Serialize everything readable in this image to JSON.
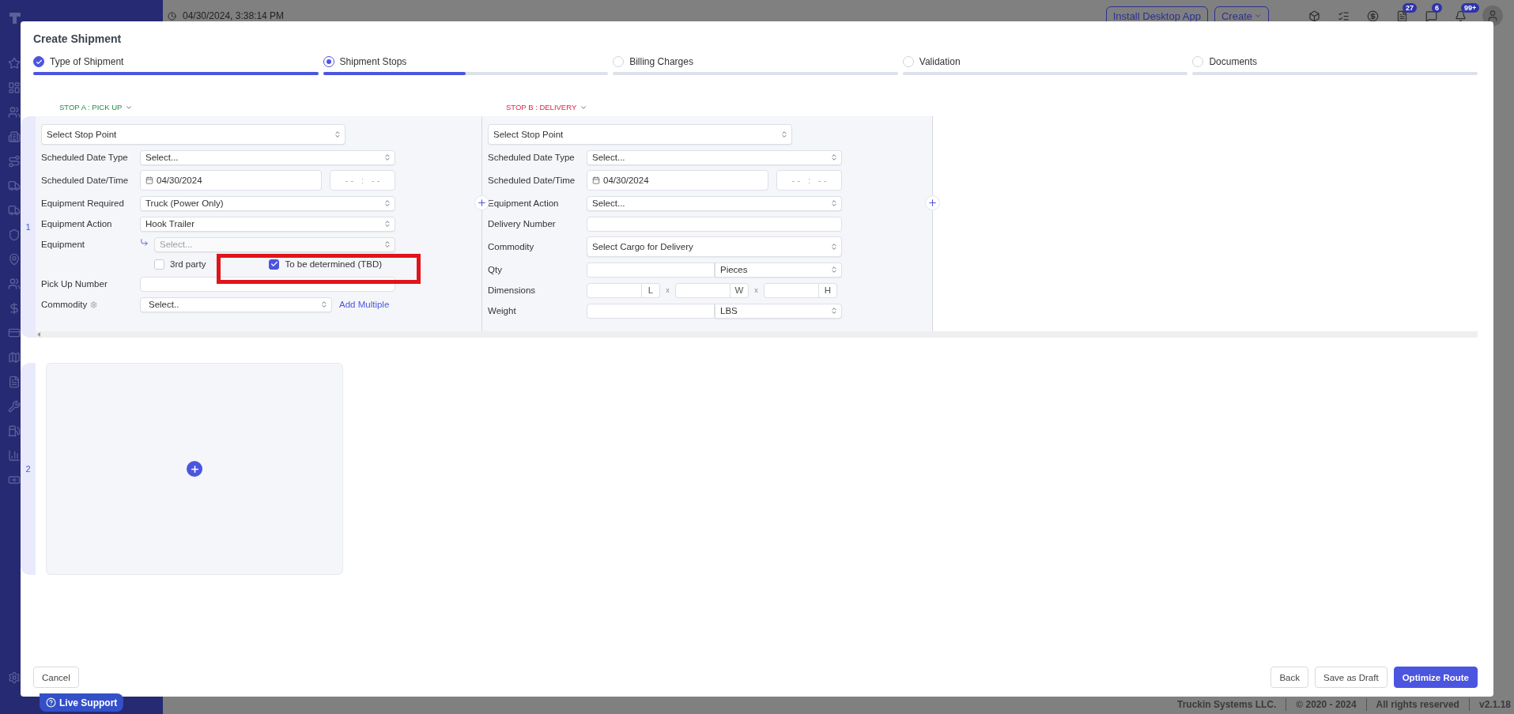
{
  "topbar": {
    "timestamp": "04/30/2024, 3:38:14 PM",
    "install_button": "Install Desktop App",
    "create_button": "Create",
    "icons": [
      {
        "kind": "box"
      },
      {
        "kind": "list"
      },
      {
        "kind": "dollar"
      },
      {
        "kind": "document",
        "badge": "27"
      },
      {
        "kind": "chat",
        "badge": "6"
      },
      {
        "kind": "bell",
        "badge": "99+"
      }
    ]
  },
  "sidebar": {
    "items": [
      {
        "kind": "star"
      },
      {
        "kind": "dashboard"
      },
      {
        "kind": "users"
      },
      {
        "kind": "building"
      },
      {
        "kind": "route"
      },
      {
        "kind": "truck"
      },
      {
        "kind": "truck"
      },
      {
        "kind": "shield"
      },
      {
        "kind": "pin"
      },
      {
        "kind": "users"
      },
      {
        "kind": "dollar"
      },
      {
        "kind": "card"
      },
      {
        "kind": "map"
      },
      {
        "kind": "document"
      },
      {
        "kind": "wrench"
      },
      {
        "kind": "fuel"
      },
      {
        "kind": "chart"
      },
      {
        "kind": "money"
      }
    ]
  },
  "modal": {
    "title": "Create Shipment",
    "steps": [
      {
        "label": "Type of Shipment",
        "kind": "done",
        "level": 1
      },
      {
        "label": "Shipment Stops",
        "kind": "current",
        "level": 0.5
      },
      {
        "label": "Billing Charges",
        "kind": "pending",
        "level": 0
      },
      {
        "label": "Validation",
        "kind": "pending",
        "level": 0
      },
      {
        "label": "Documents",
        "kind": "pending",
        "level": 0
      }
    ],
    "routes": [
      {
        "number": "1",
        "kind": "stops",
        "stops": [
          {
            "header": "STOP A : PICK UP",
            "color": "#1e8a4c",
            "fields": [
              {
                "kind": "stop_select",
                "value": "Select Stop Point"
              },
              {
                "kind": "select",
                "label": "Scheduled Date Type",
                "value": "Select..."
              },
              {
                "kind": "datetime",
                "label": "Scheduled Date/Time",
                "date": "04/30/2024",
                "time": "- -   :   - -"
              },
              {
                "kind": "select",
                "label": "Equipment Required",
                "value": "Truck (Power Only)"
              },
              {
                "kind": "select",
                "label": "Equipment Action",
                "value": "Hook Trailer"
              },
              {
                "kind": "sub_select",
                "label": "Equipment",
                "placeholder": "Select...",
                "disabled": true
              },
              {
                "kind": "checkboxes",
                "options": [
                  {
                    "label": "3rd party",
                    "checked": false,
                    "highlighted": false
                  },
                  {
                    "label": "To be determined (TBD)",
                    "checked": true,
                    "highlighted": true
                  }
                ]
              },
              {
                "kind": "input",
                "label": "Pick Up Number"
              },
              {
                "kind": "select_link",
                "label": "Commodity",
                "value": "Select..",
                "link": "Add Multiple"
              }
            ]
          },
          {
            "header": "STOP B : DELIVERY",
            "color": "#e0244f",
            "fields": [
              {
                "kind": "stop_select",
                "value": "Select Stop Point"
              },
              {
                "kind": "select",
                "label": "Scheduled Date Type",
                "value": "Select..."
              },
              {
                "kind": "datetime",
                "label": "Scheduled Date/Time",
                "date": "04/30/2024",
                "time": "- -   :   - -"
              },
              {
                "kind": "select",
                "label": "Equipment Action",
                "value": "Select..."
              },
              {
                "kind": "input",
                "label": "Delivery Number"
              },
              {
                "kind": "tall_select",
                "label": "Commodity",
                "value": "Select Cargo for Delivery"
              },
              {
                "kind": "qty",
                "label": "Qty",
                "unit": "Pieces"
              },
              {
                "kind": "dimensions",
                "label": "Dimensions",
                "units": [
                  "L",
                  "W",
                  "H"
                ],
                "separators": [
                  "x",
                  "x"
                ]
              },
              {
                "kind": "qty",
                "label": "Weight",
                "unit": "LBS"
              }
            ]
          }
        ]
      },
      {
        "number": "2",
        "kind": "empty"
      }
    ],
    "cancel": "Cancel",
    "actions": [
      {
        "label": "Back",
        "kind": "secondary"
      },
      {
        "label": "Save as Draft",
        "kind": "secondary"
      },
      {
        "label": "Optimize Route",
        "kind": "primary"
      }
    ]
  },
  "live_support": "Live Support",
  "footer": [
    "Truckin Systems LLC.",
    "© 2020 - 2024",
    "All rights reserved",
    "v2.1.18"
  ]
}
